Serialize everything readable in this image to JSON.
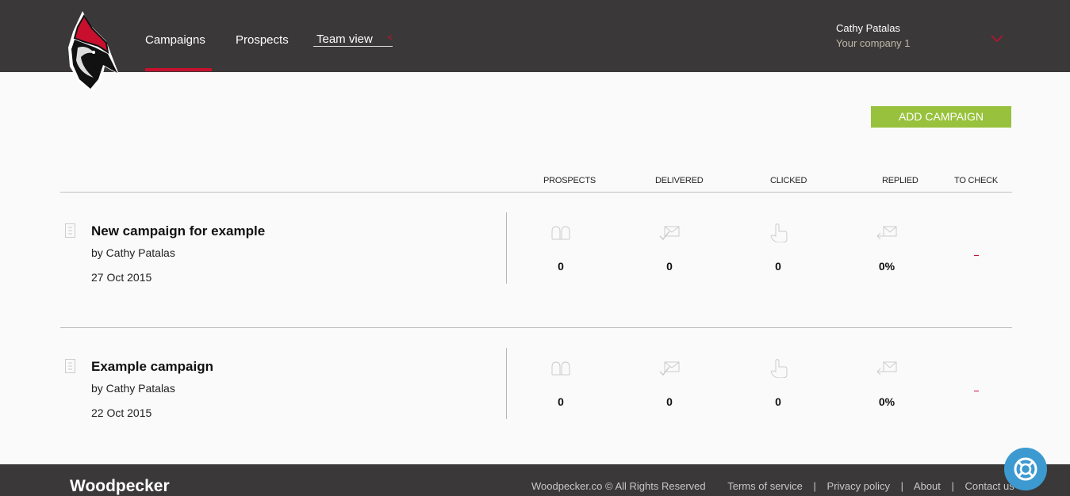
{
  "header": {
    "nav": [
      {
        "label": "Campaigns",
        "active": true
      },
      {
        "label": "Prospects",
        "active": false
      },
      {
        "label": "Team view",
        "active": false
      }
    ],
    "team_view_caret": "<",
    "user": {
      "name": "Cathy Patalas",
      "company": "Your company 1"
    }
  },
  "toolbar": {
    "add_campaign_label": "ADD CAMPAIGN"
  },
  "table": {
    "columns": [
      "PROSPECTS",
      "DELIVERED",
      "CLICKED",
      "REPLIED",
      "TO CHECK"
    ],
    "rows": [
      {
        "title": "New campaign for example",
        "author": "by Cathy Patalas",
        "date": "27 Oct 2015",
        "prospects": "0",
        "delivered": "0",
        "clicked": "0",
        "replied": "0%",
        "to_check": "-"
      },
      {
        "title": "Example campaign",
        "author": "by Cathy Patalas",
        "date": "22 Oct 2015",
        "prospects": "0",
        "delivered": "0",
        "clicked": "0",
        "replied": "0%",
        "to_check": "-"
      }
    ]
  },
  "footer": {
    "brand": "Woodpecker",
    "copyright": "Woodpecker.co © All Rights Reserved",
    "links": [
      "Terms of service",
      "Privacy policy",
      "About",
      "Contact us"
    ],
    "separator": "|"
  },
  "colors": {
    "accent": "#c8102e",
    "button": "#98c23d",
    "header_bg": "#3a3839",
    "help": "#3d9ad1"
  }
}
